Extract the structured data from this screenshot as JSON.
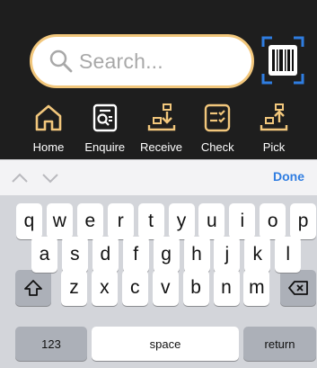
{
  "search": {
    "placeholder": "Search..."
  },
  "icons": {
    "search": "magnifier-icon",
    "barcode": "barcode-scan-icon",
    "home": "home-icon",
    "enquire": "search-document-icon",
    "receive": "receive-box-icon",
    "check": "checklist-icon",
    "pick": "pick-box-icon"
  },
  "colors": {
    "accent": "#f2c77c",
    "barcode_corner": "#2f7de1",
    "done": "#2f7de1"
  },
  "nav": [
    {
      "label": "Home"
    },
    {
      "label": "Enquire"
    },
    {
      "label": "Receive"
    },
    {
      "label": "Check"
    },
    {
      "label": "Pick"
    }
  ],
  "toolbar": {
    "done_label": "Done"
  },
  "keyboard": {
    "row1": [
      "q",
      "w",
      "e",
      "r",
      "t",
      "y",
      "u",
      "i",
      "o",
      "p"
    ],
    "row2": [
      "a",
      "s",
      "d",
      "f",
      "g",
      "h",
      "j",
      "k",
      "l"
    ],
    "row3": [
      "z",
      "x",
      "c",
      "v",
      "b",
      "n",
      "m"
    ],
    "numbers_label": "123",
    "space_label": "space",
    "return_label": "return"
  }
}
